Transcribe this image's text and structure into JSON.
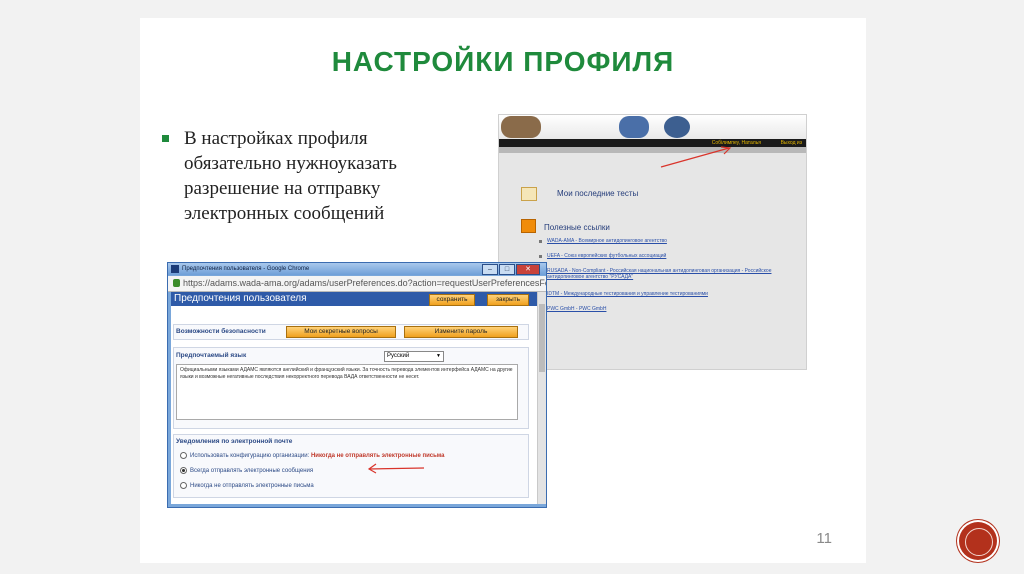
{
  "slide": {
    "title": "НАСТРОЙКИ ПРОФИЛЯ",
    "bullet_lines": [
      "В настройках профиля",
      "обязательно нужноуказать",
      "разрешение на отправку",
      "электронных сообщений"
    ],
    "page_number": "11",
    "accent": "#1f8a3c"
  },
  "right_shot": {
    "user_link": "Собілимпеу, Наталья",
    "exit_link": "Выход из",
    "section1": "Мои последние тесты",
    "section2": "Полезные ссылки",
    "links": [
      "WADA-AMA - Всемирное антидопинговое агентство",
      "UEFA - Союз европейских футбольных ассоциаций",
      "RUSADA - Non-Compliant - Российская национальная антидопинговая организация - Российское антидопинговое агентство \"РУСАДА\"",
      "IDTM - Международные тестирования и управление тестированиями",
      "PWC GmbH - PWC GmbH"
    ]
  },
  "browser": {
    "title": "Предпочтения пользователя - Google Chrome",
    "url": "https://adams.wada-ama.org/adams/userPreferences.do?action=requestUserPreferencesFo",
    "window_buttons": [
      "–",
      "□",
      "✕"
    ]
  },
  "prefs": {
    "header": "Предпочтения пользователя",
    "save": "сохранить",
    "close": "закрыть",
    "security_label": "Возможности безопасности",
    "secret_questions": "Мои секретные вопросы",
    "change_password": "Измените пароль",
    "lang_label": "Предпочтаемый язык",
    "lang_value": "Русский",
    "lang_note": "Официальными языками АДАМС являются английский и французский языки. За точность перевода элементов интерфейса АДАМС на другие языки и возможные негативные последствия некорректного перевода ВАДА ответственности не несет.",
    "email_label": "Уведомления по электронной почте",
    "opt1": "Использовать конфигурацию организации:",
    "opt1_note": "Никогда не отправлять электронные письма",
    "opt2": "Всегда отправлять электронные сообщения",
    "opt3": "Никогда не отправлять электронные письма"
  }
}
